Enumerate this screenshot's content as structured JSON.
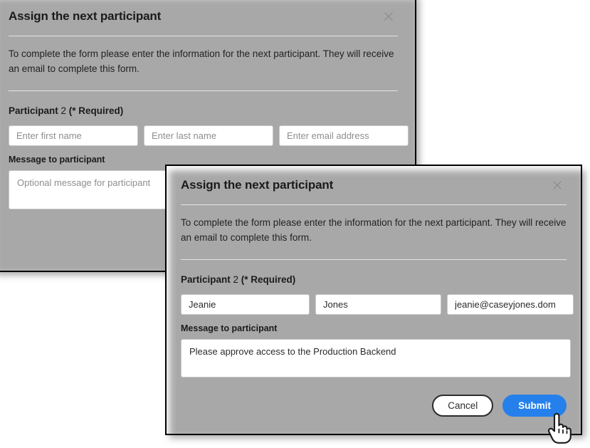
{
  "app": {
    "background_color": "#ffffff",
    "accent_color": "#2680eb",
    "border_color": "#000000"
  },
  "dialog_back": {
    "name": "background-dialog",
    "title": "Assign the next participant",
    "close_icon": "close-icon",
    "description": "To complete the form please enter the information for the next participant. They will receive an email to complete this form.",
    "participant_label_bold": "Participant",
    "participant_number": " 2 ",
    "participant_required": "(* Required)",
    "fields": {
      "first_name_placeholder": "Enter first name",
      "first_name_value": "",
      "last_name_placeholder": "Enter last name",
      "last_name_value": "",
      "email_placeholder": "Enter email address",
      "email_value": ""
    },
    "message_label": "Message to participant",
    "message_placeholder": "Optional message for participant",
    "message_value": ""
  },
  "dialog_front": {
    "name": "foreground-dialog",
    "title": "Assign the next participant",
    "close_icon": "close-icon",
    "description": "To complete the form please enter the information for the next participant. They will receive an email to complete this form.",
    "participant_label_bold": "Participant",
    "participant_number": " 2 ",
    "participant_required": "(* Required)",
    "fields": {
      "first_name_placeholder": "Enter first name",
      "first_name_value": "Jeanie",
      "last_name_placeholder": "Enter last name",
      "last_name_value": "Jones",
      "email_placeholder": "Enter email address",
      "email_value": "jeanie@caseyjones.dom"
    },
    "message_label": "Message to participant",
    "message_placeholder": "Optional message for participant",
    "message_value": "Please approve access to the Production Backend",
    "buttons": {
      "cancel_label": "Cancel",
      "submit_label": "Submit"
    }
  },
  "cursor": {
    "icon": "pointing-hand-cursor"
  }
}
